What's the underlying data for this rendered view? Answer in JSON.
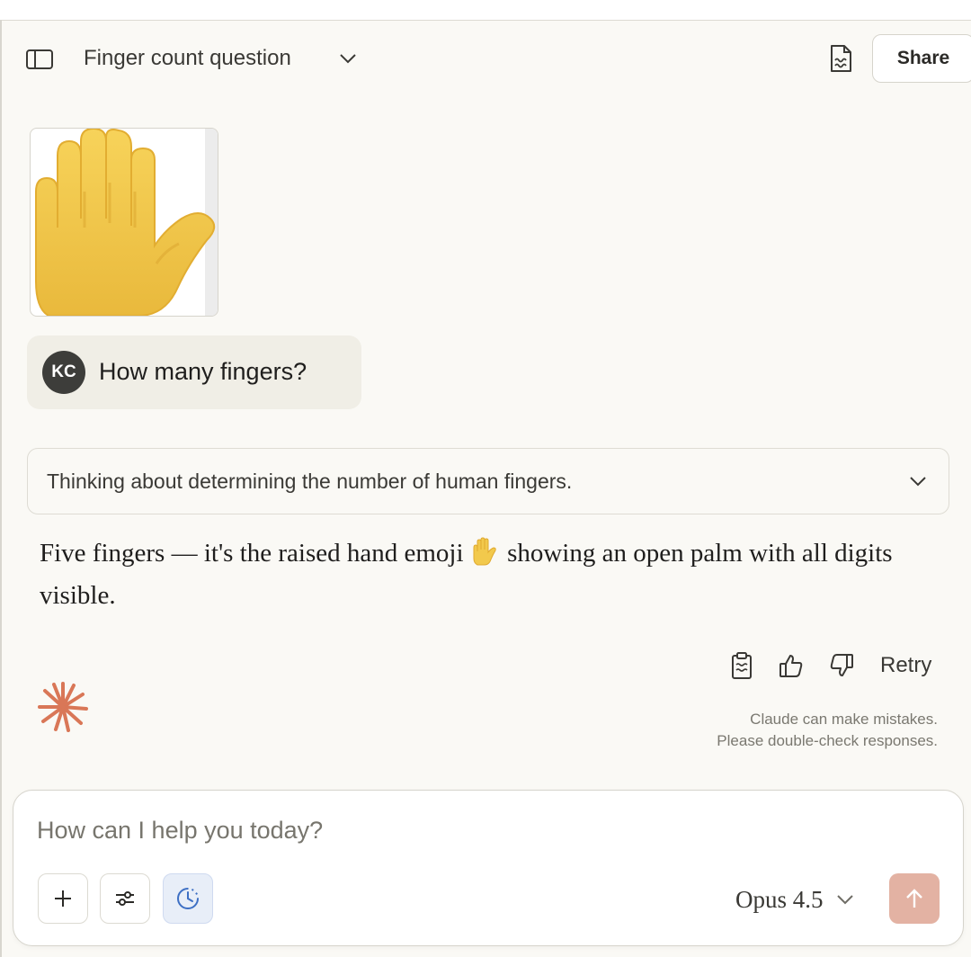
{
  "header": {
    "title": "Finger count question",
    "share_label": "Share"
  },
  "conversation": {
    "user": {
      "avatar_initials": "KC",
      "message": "How many fingers?",
      "attachment_icon": "raised-hand-emoji"
    },
    "thinking": {
      "summary": "Thinking about determining the number of human fingers."
    },
    "response": {
      "line_before_emoji": "Five fingers — it's the raised hand emoji",
      "emoji": "🖐",
      "line_after_emoji": "showing an open palm with all digits visible."
    },
    "actions": {
      "retry_label": "Retry",
      "icons": [
        "copy-icon",
        "thumbs-up-icon",
        "thumbs-down-icon"
      ]
    },
    "disclaimer": {
      "line1": "Claude can make mistakes.",
      "line2": "Please double-check responses."
    }
  },
  "composer": {
    "placeholder": "How can I help you today?",
    "value": "",
    "model": "Opus 4.5",
    "buttons": [
      "plus-icon",
      "sliders-icon",
      "clock-icon",
      "arrow-up-icon"
    ]
  },
  "colors": {
    "background": "#faf9f5",
    "claude_accent": "#d97757",
    "send_button": "#e3b2a3",
    "user_bubble": "#f0eee6",
    "hand_yellow": "#f2c94c"
  }
}
